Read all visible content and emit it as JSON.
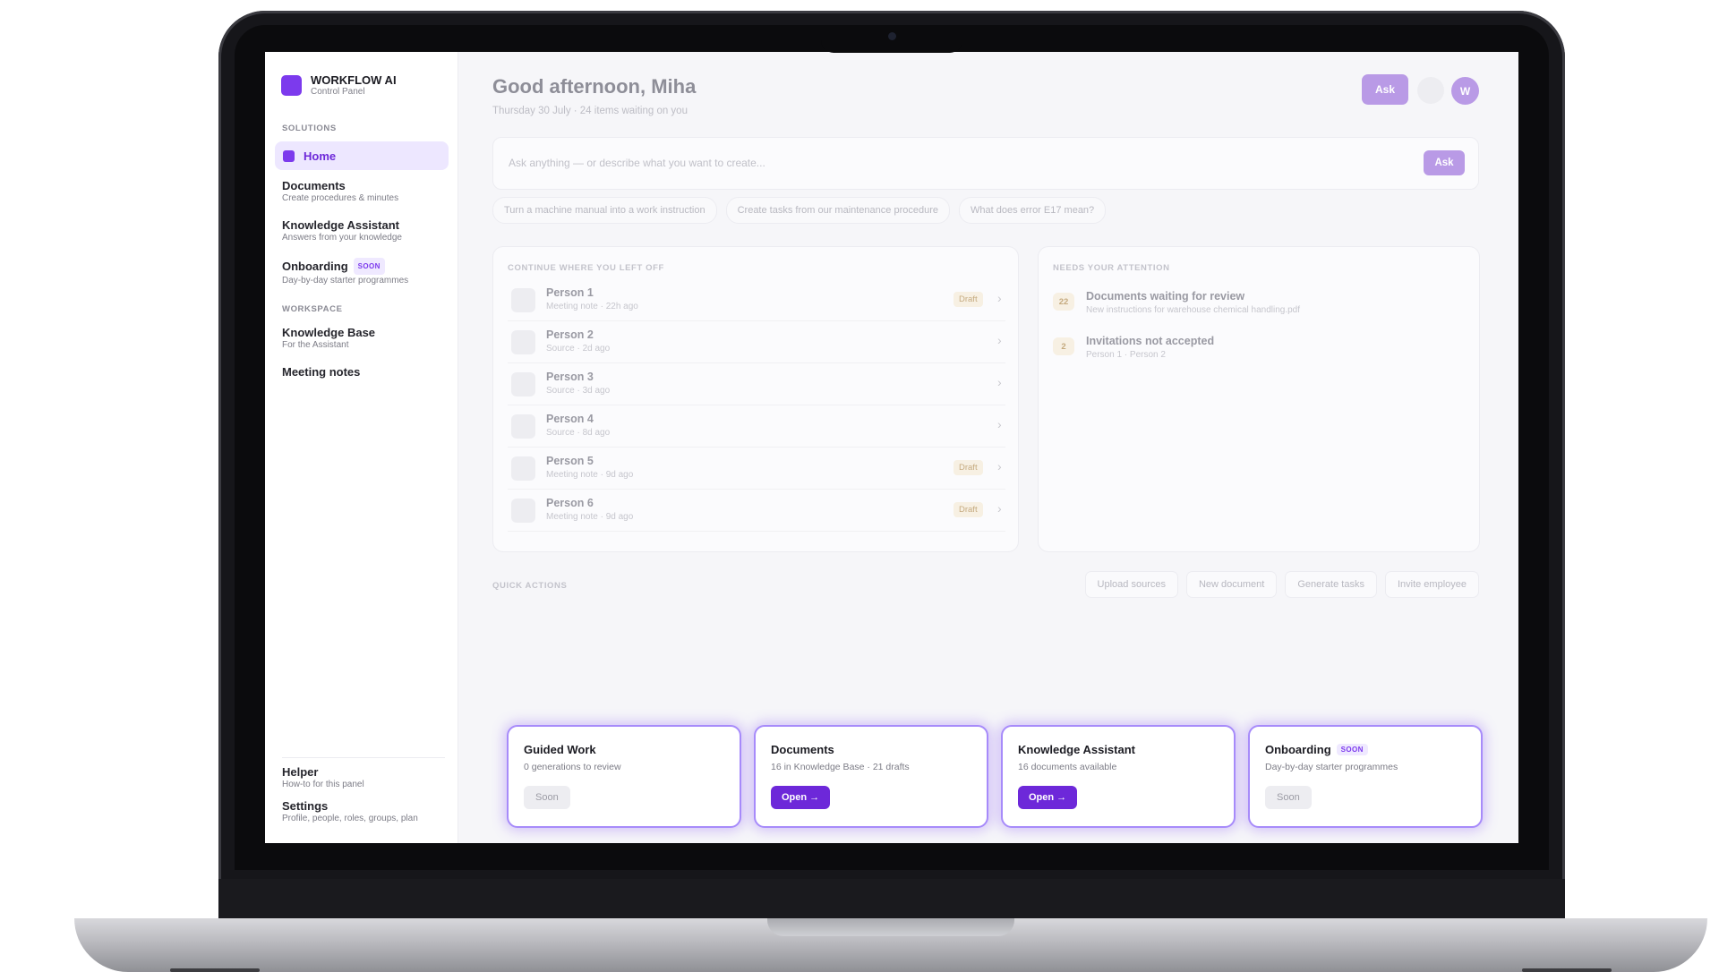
{
  "brand": {
    "name": "WORKFLOW AI",
    "subtitle": "Control Panel"
  },
  "sidebar": {
    "solutions_heading": "SOLUTIONS",
    "home_label": "Home",
    "solutions": [
      {
        "title": "Documents",
        "sub": "Create procedures & minutes"
      },
      {
        "title": "Knowledge Assistant",
        "sub": "Answers from your knowledge"
      },
      {
        "title": "Onboarding",
        "badge": "SOON",
        "sub": "Day-by-day starter programmes"
      }
    ],
    "workspace_heading": "WORKSPACE",
    "workspace": [
      {
        "title": "Knowledge Base",
        "sub": "For the Assistant"
      },
      {
        "title": "Meeting notes"
      }
    ],
    "footer": [
      {
        "title": "Helper",
        "sub": "How-to for this panel"
      },
      {
        "title": "Settings",
        "sub": "Profile, people, roles, groups, plan"
      }
    ]
  },
  "header": {
    "greeting": "Good afternoon, Miha",
    "subline": "Thursday 30 July · 24 items waiting on you",
    "ask_label": "Ask",
    "avatar_initial": "W"
  },
  "ask": {
    "placeholder": "Ask anything — or describe what you want to create...",
    "button": "Ask"
  },
  "suggestions": [
    "Turn a machine manual into a work instruction",
    "Create tasks from our maintenance procedure",
    "What does error E17 mean?"
  ],
  "continue": {
    "heading": "CONTINUE WHERE YOU LEFT OFF",
    "rows": [
      {
        "name": "Person 1",
        "meta": "Meeting note · 22h ago",
        "badge": "Draft"
      },
      {
        "name": "Person 2",
        "meta": "Source · 2d ago",
        "badge": ""
      },
      {
        "name": "Person 3",
        "meta": "Source · 3d ago",
        "badge": ""
      },
      {
        "name": "Person 4",
        "meta": "Source · 8d ago",
        "badge": ""
      },
      {
        "name": "Person 5",
        "meta": "Meeting note · 9d ago",
        "badge": "Draft"
      },
      {
        "name": "Person 6",
        "meta": "Meeting note · 9d ago",
        "badge": "Draft"
      }
    ]
  },
  "attention": {
    "heading": "NEEDS YOUR ATTENTION",
    "items": [
      {
        "count": "22",
        "title": "Documents waiting for review",
        "sub": "New instructions for warehouse chemical handling.pdf"
      },
      {
        "count": "2",
        "title": "Invitations not accepted",
        "sub": "Person 1 · Person 2"
      }
    ]
  },
  "quick_actions": {
    "heading": "QUICK ACTIONS",
    "buttons": [
      "Upload sources",
      "New document",
      "Generate tasks",
      "Invite employee"
    ]
  },
  "cards": [
    {
      "title": "Guided Work",
      "badge": "",
      "sub": "0 generations to review",
      "button": "Soon",
      "button_kind": "soon"
    },
    {
      "title": "Documents",
      "badge": "",
      "sub": "16 in Knowledge Base · 21 drafts",
      "button": "Open →",
      "button_kind": "open"
    },
    {
      "title": "Knowledge Assistant",
      "badge": "",
      "sub": "16 documents available",
      "button": "Open →",
      "button_kind": "open"
    },
    {
      "title": "Onboarding",
      "badge": "SOON",
      "sub": "Day-by-day starter programmes",
      "button": "Soon",
      "button_kind": "soon"
    }
  ],
  "colors": {
    "accent": "#7c3aed",
    "accent_dark": "#6d28d9",
    "highlight_border": "#a78bfa"
  }
}
